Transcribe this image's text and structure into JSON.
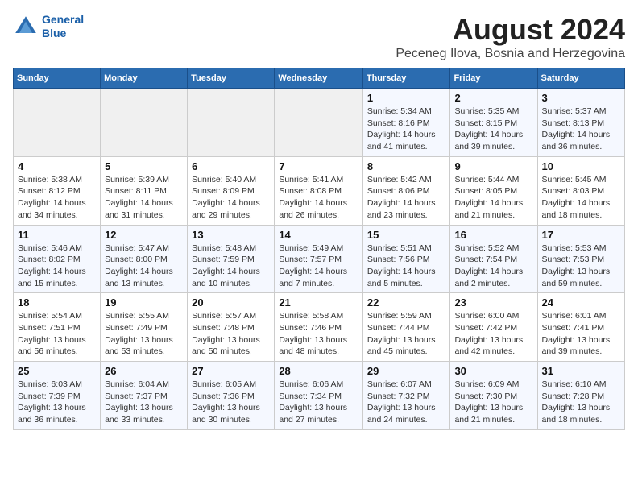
{
  "header": {
    "logo_line1": "General",
    "logo_line2": "Blue",
    "month": "August 2024",
    "location": "Peceneg Ilova, Bosnia and Herzegovina"
  },
  "weekdays": [
    "Sunday",
    "Monday",
    "Tuesday",
    "Wednesday",
    "Thursday",
    "Friday",
    "Saturday"
  ],
  "weeks": [
    [
      {
        "day": "",
        "info": ""
      },
      {
        "day": "",
        "info": ""
      },
      {
        "day": "",
        "info": ""
      },
      {
        "day": "",
        "info": ""
      },
      {
        "day": "1",
        "info": "Sunrise: 5:34 AM\nSunset: 8:16 PM\nDaylight: 14 hours\nand 41 minutes."
      },
      {
        "day": "2",
        "info": "Sunrise: 5:35 AM\nSunset: 8:15 PM\nDaylight: 14 hours\nand 39 minutes."
      },
      {
        "day": "3",
        "info": "Sunrise: 5:37 AM\nSunset: 8:13 PM\nDaylight: 14 hours\nand 36 minutes."
      }
    ],
    [
      {
        "day": "4",
        "info": "Sunrise: 5:38 AM\nSunset: 8:12 PM\nDaylight: 14 hours\nand 34 minutes."
      },
      {
        "day": "5",
        "info": "Sunrise: 5:39 AM\nSunset: 8:11 PM\nDaylight: 14 hours\nand 31 minutes."
      },
      {
        "day": "6",
        "info": "Sunrise: 5:40 AM\nSunset: 8:09 PM\nDaylight: 14 hours\nand 29 minutes."
      },
      {
        "day": "7",
        "info": "Sunrise: 5:41 AM\nSunset: 8:08 PM\nDaylight: 14 hours\nand 26 minutes."
      },
      {
        "day": "8",
        "info": "Sunrise: 5:42 AM\nSunset: 8:06 PM\nDaylight: 14 hours\nand 23 minutes."
      },
      {
        "day": "9",
        "info": "Sunrise: 5:44 AM\nSunset: 8:05 PM\nDaylight: 14 hours\nand 21 minutes."
      },
      {
        "day": "10",
        "info": "Sunrise: 5:45 AM\nSunset: 8:03 PM\nDaylight: 14 hours\nand 18 minutes."
      }
    ],
    [
      {
        "day": "11",
        "info": "Sunrise: 5:46 AM\nSunset: 8:02 PM\nDaylight: 14 hours\nand 15 minutes."
      },
      {
        "day": "12",
        "info": "Sunrise: 5:47 AM\nSunset: 8:00 PM\nDaylight: 14 hours\nand 13 minutes."
      },
      {
        "day": "13",
        "info": "Sunrise: 5:48 AM\nSunset: 7:59 PM\nDaylight: 14 hours\nand 10 minutes."
      },
      {
        "day": "14",
        "info": "Sunrise: 5:49 AM\nSunset: 7:57 PM\nDaylight: 14 hours\nand 7 minutes."
      },
      {
        "day": "15",
        "info": "Sunrise: 5:51 AM\nSunset: 7:56 PM\nDaylight: 14 hours\nand 5 minutes."
      },
      {
        "day": "16",
        "info": "Sunrise: 5:52 AM\nSunset: 7:54 PM\nDaylight: 14 hours\nand 2 minutes."
      },
      {
        "day": "17",
        "info": "Sunrise: 5:53 AM\nSunset: 7:53 PM\nDaylight: 13 hours\nand 59 minutes."
      }
    ],
    [
      {
        "day": "18",
        "info": "Sunrise: 5:54 AM\nSunset: 7:51 PM\nDaylight: 13 hours\nand 56 minutes."
      },
      {
        "day": "19",
        "info": "Sunrise: 5:55 AM\nSunset: 7:49 PM\nDaylight: 13 hours\nand 53 minutes."
      },
      {
        "day": "20",
        "info": "Sunrise: 5:57 AM\nSunset: 7:48 PM\nDaylight: 13 hours\nand 50 minutes."
      },
      {
        "day": "21",
        "info": "Sunrise: 5:58 AM\nSunset: 7:46 PM\nDaylight: 13 hours\nand 48 minutes."
      },
      {
        "day": "22",
        "info": "Sunrise: 5:59 AM\nSunset: 7:44 PM\nDaylight: 13 hours\nand 45 minutes."
      },
      {
        "day": "23",
        "info": "Sunrise: 6:00 AM\nSunset: 7:42 PM\nDaylight: 13 hours\nand 42 minutes."
      },
      {
        "day": "24",
        "info": "Sunrise: 6:01 AM\nSunset: 7:41 PM\nDaylight: 13 hours\nand 39 minutes."
      }
    ],
    [
      {
        "day": "25",
        "info": "Sunrise: 6:03 AM\nSunset: 7:39 PM\nDaylight: 13 hours\nand 36 minutes."
      },
      {
        "day": "26",
        "info": "Sunrise: 6:04 AM\nSunset: 7:37 PM\nDaylight: 13 hours\nand 33 minutes."
      },
      {
        "day": "27",
        "info": "Sunrise: 6:05 AM\nSunset: 7:36 PM\nDaylight: 13 hours\nand 30 minutes."
      },
      {
        "day": "28",
        "info": "Sunrise: 6:06 AM\nSunset: 7:34 PM\nDaylight: 13 hours\nand 27 minutes."
      },
      {
        "day": "29",
        "info": "Sunrise: 6:07 AM\nSunset: 7:32 PM\nDaylight: 13 hours\nand 24 minutes."
      },
      {
        "day": "30",
        "info": "Sunrise: 6:09 AM\nSunset: 7:30 PM\nDaylight: 13 hours\nand 21 minutes."
      },
      {
        "day": "31",
        "info": "Sunrise: 6:10 AM\nSunset: 7:28 PM\nDaylight: 13 hours\nand 18 minutes."
      }
    ]
  ]
}
